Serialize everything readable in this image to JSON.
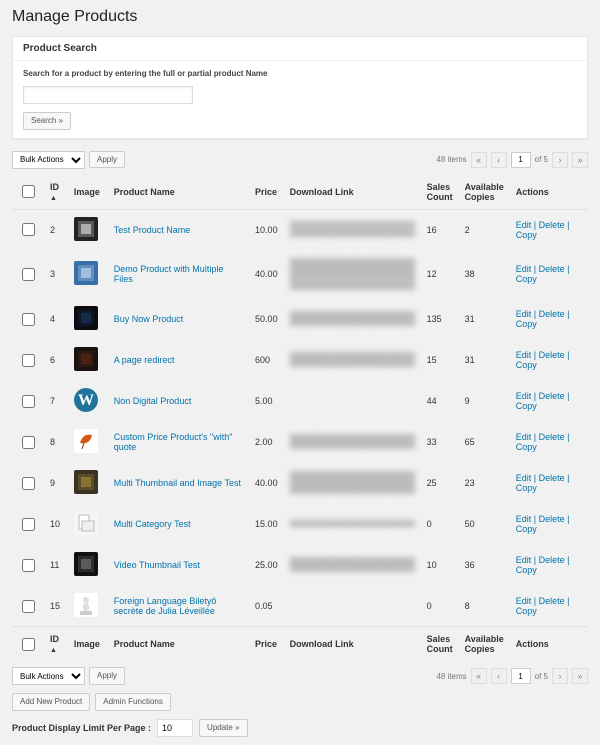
{
  "title": "Manage Products",
  "search": {
    "heading": "Product Search",
    "help": "Search for a product by entering the full or partial product Name",
    "value": "",
    "button": "Search »"
  },
  "bulk": {
    "label": "Bulk Actions",
    "apply": "Apply"
  },
  "pagination": {
    "items_text": "48 items",
    "page": "1",
    "of": "of 5",
    "first": "«",
    "prev": "‹",
    "next": "›",
    "last": "»"
  },
  "columns": {
    "cb": "",
    "id": "ID",
    "image": "Image",
    "name": "Product Name",
    "price": "Price",
    "download": "Download Link",
    "sales": "Sales Count",
    "available": "Available Copies",
    "actions": "Actions"
  },
  "sort_caret": "▲",
  "actions": {
    "edit": "Edit",
    "delete": "Delete",
    "copy": "Copy"
  },
  "rows": [
    {
      "id": "2",
      "thumb": {
        "bg": "#222",
        "accent": "#fff"
      },
      "name": "Test Product Name",
      "price": "10.00",
      "dl_lines": 2,
      "sales": "16",
      "avail": "2"
    },
    {
      "id": "3",
      "thumb": {
        "bg": "#3a6ea8",
        "accent": "#dcefff"
      },
      "name": "Demo Product with Multiple Files",
      "price": "40.00",
      "dl_lines": 4,
      "sales": "12",
      "avail": "38"
    },
    {
      "id": "4",
      "thumb": {
        "bg": "#0b0b10",
        "accent": "#1b3b6b"
      },
      "name": "Buy Now Product",
      "price": "50.00",
      "dl_lines": 2,
      "sales": "135",
      "avail": "31"
    },
    {
      "id": "6",
      "thumb": {
        "bg": "#1a1210",
        "accent": "#6b2a1a"
      },
      "name": "A page redirect",
      "price": "600",
      "dl_lines": 2,
      "sales": "15",
      "avail": "31"
    },
    {
      "id": "7",
      "thumb": {
        "bg": "#21759b",
        "accent": "#fff",
        "wp": true
      },
      "name": "Non Digital Product",
      "price": "5.00",
      "dl_lines": 0,
      "sales": "44",
      "avail": "9"
    },
    {
      "id": "8",
      "thumb": {
        "bg": "#fff",
        "accent": "#d25a16",
        "leaf": true
      },
      "name": "Custom Price Product's \"with\" quote",
      "price": "2.00",
      "dl_lines": 2,
      "sales": "33",
      "avail": "65"
    },
    {
      "id": "9",
      "thumb": {
        "bg": "#3a3324",
        "accent": "#b89a3d"
      },
      "name": "Multi Thumbnail and Image Test",
      "price": "40.00",
      "dl_lines": 3,
      "sales": "25",
      "avail": "23"
    },
    {
      "id": "10",
      "thumb": {
        "bg": "#f5f5f5",
        "accent": "#bbb",
        "box": true
      },
      "name": "Multi Category Test",
      "price": "15.00",
      "dl_lines": 1,
      "sales": "0",
      "avail": "50"
    },
    {
      "id": "11",
      "thumb": {
        "bg": "#111",
        "accent": "#888"
      },
      "name": "Video Thumbnail Test",
      "price": "25.00",
      "dl_lines": 2,
      "sales": "10",
      "avail": "36"
    },
    {
      "id": "15",
      "thumb": {
        "bg": "#fff",
        "accent": "#ddd",
        "figure": true
      },
      "name": "Foreign Language Biletyô secrète de Julia Léveillée",
      "price": "0.05",
      "dl_lines": 0,
      "sales": "0",
      "avail": "8"
    }
  ],
  "bottom_buttons": {
    "add": "Add New Product",
    "admin": "Admin Functions"
  },
  "limit": {
    "label": "Product Display Limit Per Page :",
    "value": "10",
    "update": "Update »"
  }
}
